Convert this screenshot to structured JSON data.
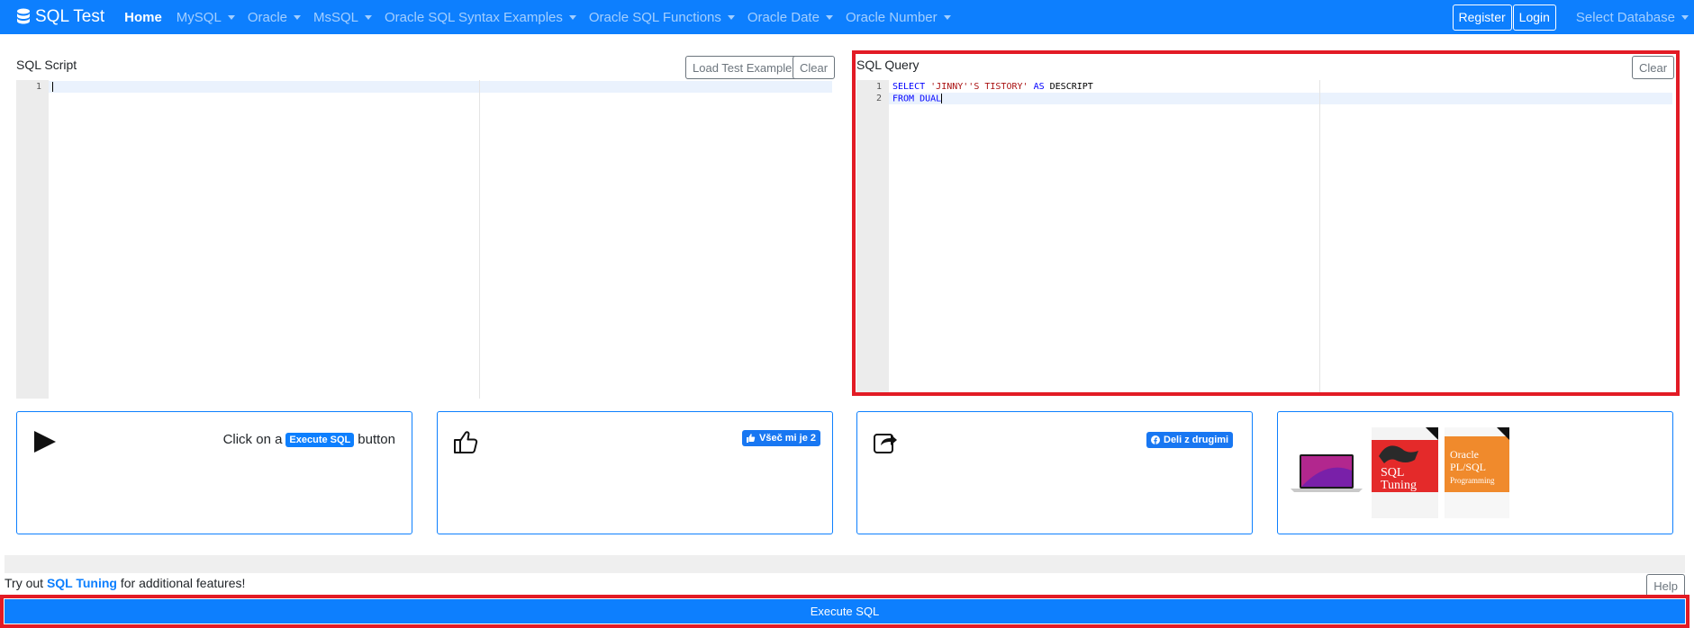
{
  "navbar": {
    "brand": "SQL Test",
    "items": [
      {
        "label": "Home",
        "active": true,
        "dropdown": false
      },
      {
        "label": "MySQL",
        "dropdown": true
      },
      {
        "label": "Oracle",
        "dropdown": true
      },
      {
        "label": "MsSQL",
        "dropdown": true
      },
      {
        "label": "Oracle SQL Syntax Examples",
        "dropdown": true
      },
      {
        "label": "Oracle SQL Functions",
        "dropdown": true
      },
      {
        "label": "Oracle Date",
        "dropdown": true
      },
      {
        "label": "Oracle Number",
        "dropdown": true
      }
    ],
    "register_label": "Register",
    "login_label": "Login",
    "select_database_label": "Select Database"
  },
  "script_panel": {
    "title": "SQL Script",
    "load_example_label": "Load Test Example",
    "clear_label": "Clear",
    "line_numbers": [
      "1"
    ]
  },
  "query_panel": {
    "title": "SQL Query",
    "clear_label": "Clear",
    "line_numbers": [
      "1",
      "2"
    ],
    "code": {
      "l1_kw1": "SELECT",
      "l1_str": "'JINNY''S TISTORY'",
      "l1_kw2": "AS",
      "l1_ident": "DESCRIPT",
      "l2_kw1": "FROM",
      "l2_ident": "DUAL"
    }
  },
  "cards": {
    "execute_hint_pre": "Click on a",
    "execute_hint_badge": "Execute SQL",
    "execute_hint_post": "button",
    "like_label": "Všeč mi je 2",
    "share_label": "Deli z drugimi"
  },
  "footer": {
    "try_pre": "Try out",
    "try_link": "SQL Tuning",
    "try_post": "for additional features!",
    "help_label": "Help",
    "execute_label": "Execute SQL"
  },
  "book_covers": {
    "sql_tuning_title": "SQL Tuning",
    "plsql_title": "Oracle PL/SQL Programming"
  },
  "colors": {
    "primary": "#0d7ffe",
    "highlight": "#e21b25",
    "facebook": "#1877f2"
  }
}
